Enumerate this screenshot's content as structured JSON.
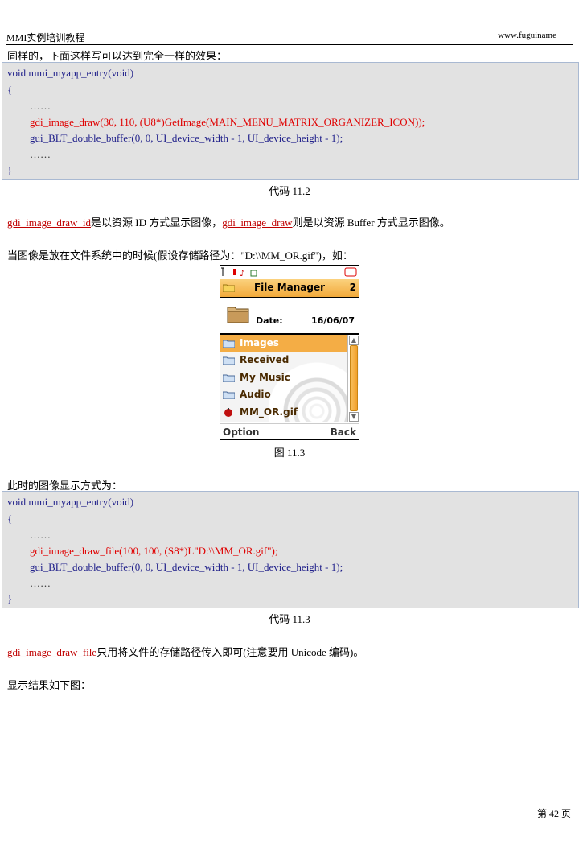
{
  "header": {
    "left": "MMI实例培训教程",
    "right": "www.fuguiname"
  },
  "p1": "同样的，下面这样写可以达到完全一样的效果：",
  "code1": [
    "void mmi_myapp_entry(void)",
    "{",
    "……",
    "gdi_image_draw(30, 110,    (U8*)GetImage(MAIN_MENU_MATRIX_ORGANIZER_ICON));",
    "gui_BLT_double_buffer(0, 0, UI_device_width - 1, UI_device_height - 1);",
    "……",
    "}"
  ],
  "caption1": "代码 11.2",
  "p2": {
    "fn1": "gdi_image_draw_id",
    "t1": "是以资源 ID 方式显示图像，",
    "fn2": "gdi_image_draw",
    "t2": "则是以资源 Buffer 方式显示图像。"
  },
  "p3": "当图像是放在文件系统中的时候(假设存储路径为：\"D:\\\\MM_OR.gif\")，如：",
  "phone": {
    "title": "File Manager",
    "title_num": "2",
    "date_label": "Date:",
    "date_value": "16/06/07",
    "items": [
      "Images",
      "Received",
      "My Music",
      "Audio",
      "MM_OR.gif"
    ],
    "soft_left": "Option",
    "soft_right": "Back",
    "colors": {
      "accent": "#f4ad45",
      "scroll": "#f2a02a"
    }
  },
  "caption2": "图 11.3",
  "p4": "此时的图像显示方式为：",
  "code2": [
    "void mmi_myapp_entry(void)",
    "{",
    "……",
    "gdi_image_draw_file(100, 100, (S8*)L\"D:\\\\MM_OR.gif\");",
    "gui_BLT_double_buffer(0, 0, UI_device_width - 1, UI_device_height - 1);",
    "……",
    "}"
  ],
  "caption3": "代码 11.3",
  "p5": {
    "fn": "gdi_image_draw_file",
    "t": "只用将文件的存储路径传入即可(注意要用 Unicode 编码)。"
  },
  "p6": "显示结果如下图：",
  "page_number": "第 42 页"
}
